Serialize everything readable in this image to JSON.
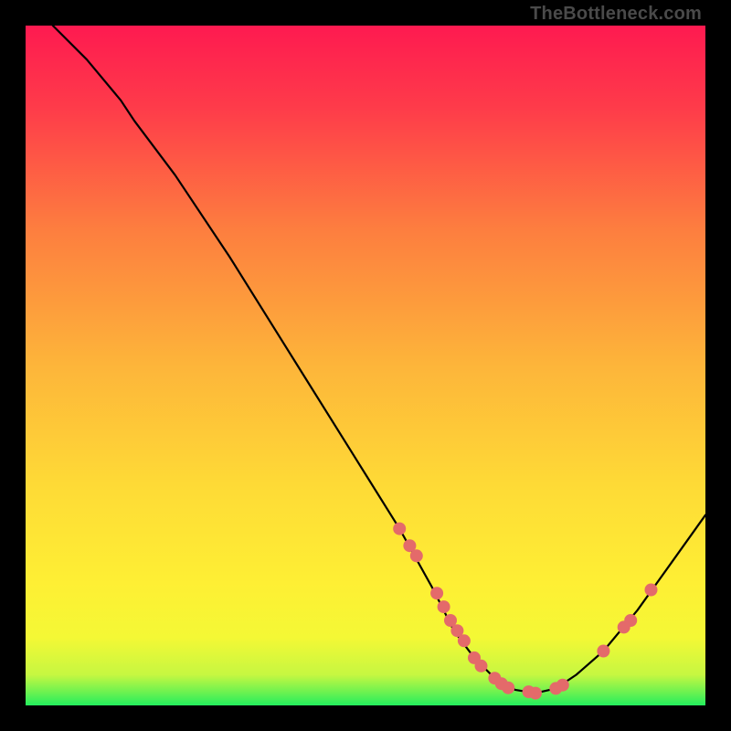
{
  "watermark": "TheBottleneck.com",
  "colors": {
    "gradient_top": "#fe1a50",
    "gradient_mid": "#fee734",
    "gradient_bottom": "#2aee5c",
    "curve": "#000000",
    "point_fill": "#e46a6a",
    "point_stroke": "#b74e4e"
  },
  "chart_data": {
    "type": "line",
    "title": "",
    "xlabel": "",
    "ylabel": "",
    "xlim": [
      0,
      100
    ],
    "ylim": [
      0,
      100
    ],
    "curve": [
      {
        "x": 4,
        "y": 100
      },
      {
        "x": 9,
        "y": 95
      },
      {
        "x": 14,
        "y": 89
      },
      {
        "x": 16,
        "y": 86
      },
      {
        "x": 22,
        "y": 78
      },
      {
        "x": 30,
        "y": 66
      },
      {
        "x": 40,
        "y": 50
      },
      {
        "x": 50,
        "y": 34
      },
      {
        "x": 55,
        "y": 26
      },
      {
        "x": 60,
        "y": 17
      },
      {
        "x": 63,
        "y": 11
      },
      {
        "x": 66,
        "y": 7
      },
      {
        "x": 69,
        "y": 4
      },
      {
        "x": 72,
        "y": 2.3
      },
      {
        "x": 75,
        "y": 1.8
      },
      {
        "x": 78,
        "y": 2.5
      },
      {
        "x": 81,
        "y": 4.5
      },
      {
        "x": 85,
        "y": 8
      },
      {
        "x": 90,
        "y": 14
      },
      {
        "x": 95,
        "y": 21
      },
      {
        "x": 100,
        "y": 28
      }
    ],
    "points": [
      {
        "x": 55,
        "y": 26
      },
      {
        "x": 56.5,
        "y": 23.5
      },
      {
        "x": 57.5,
        "y": 22
      },
      {
        "x": 60.5,
        "y": 16.5
      },
      {
        "x": 61.5,
        "y": 14.5
      },
      {
        "x": 62.5,
        "y": 12.5
      },
      {
        "x": 63.5,
        "y": 11
      },
      {
        "x": 64.5,
        "y": 9.5
      },
      {
        "x": 66,
        "y": 7
      },
      {
        "x": 67,
        "y": 5.8
      },
      {
        "x": 69,
        "y": 4
      },
      {
        "x": 70,
        "y": 3.2
      },
      {
        "x": 71,
        "y": 2.6
      },
      {
        "x": 74,
        "y": 2
      },
      {
        "x": 75,
        "y": 1.8
      },
      {
        "x": 78,
        "y": 2.5
      },
      {
        "x": 79,
        "y": 3
      },
      {
        "x": 85,
        "y": 8
      },
      {
        "x": 88,
        "y": 11.5
      },
      {
        "x": 89,
        "y": 12.5
      },
      {
        "x": 92,
        "y": 17
      }
    ]
  }
}
